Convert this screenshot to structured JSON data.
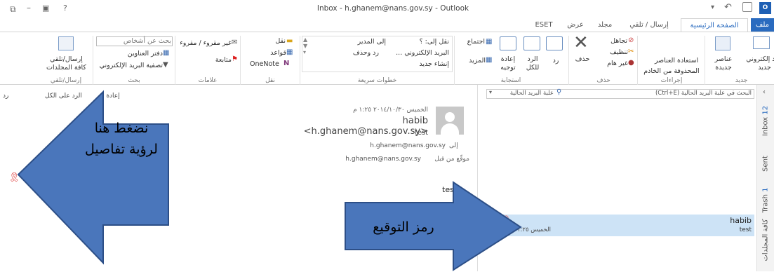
{
  "window": {
    "title": "Inbox - h.ghanem@nans.gov.sy - Outlook"
  },
  "tabs": {
    "file": "ملف",
    "home": "الصفحة الرئيسية",
    "send_receive": "إرسال / تلقي",
    "folder": "مجلد",
    "view": "عرض",
    "eset": "ESET"
  },
  "ribbon": {
    "new": {
      "new_email": "بريد إلكتروني جديد",
      "new_items": "عناصر جديدة",
      "label": "جديد"
    },
    "actions": {
      "restore": "استعادة العناصر",
      "from_server": "المحذوفة من الخادم",
      "label": "إجراءات"
    },
    "delete": {
      "ignore": "تجاهل",
      "cleanup": "تنظيف",
      "junk": "غير هام",
      "delete": "حذف",
      "label": "حذف"
    },
    "respond": {
      "reply": "رد",
      "reply_all": "الرد للكل",
      "forward": "إعادة توجيه",
      "meeting": "اجتماع",
      "more": "المزيد",
      "label": "استجابة"
    },
    "quicksteps": {
      "move_to": "نقل إلى: ؟",
      "to_manager": "إلى المدير",
      "team_email": "البريد الإلكتروني ...",
      "reply_delete": "رد وحذف",
      "create_new": "إنشاء جديد",
      "label": "خطوات سريعة"
    },
    "move": {
      "move": "نقل",
      "rules": "قواعد",
      "onenote": "OneNote",
      "label": "نقل"
    },
    "tags": {
      "unread": "غير مقروء / مقروء",
      "followup": "متابعة",
      "label": "علامات"
    },
    "find": {
      "search_people": "بحث عن أشخاص",
      "address_book": "دفتر العناوين",
      "filter_email": "تصفية البريد الإلكتروني",
      "label": "بحث"
    },
    "sendrecv": {
      "btn": "إرسال/تلقي كافة المجلدات",
      "label": "إرسال/تلقي"
    }
  },
  "mail_list": {
    "search_placeholder": "البحث في علبة البريد الحالية (Ctrl+E)",
    "scope": "علبة البريد الحالية",
    "item": {
      "sender": "habib",
      "subject": "test",
      "date": "الخميس ١:٢٥ م"
    }
  },
  "reading": {
    "reply_all": "الرد على الكل",
    "reply": "رد",
    "forward": "إعادة ت",
    "date": "الخميس ٢٠١٤/١٠/٣٠ ١:٢٥ م",
    "from": "habib <h.ghanem@nans.gov.sy>",
    "subject": "test",
    "to_label": "إلى",
    "to_value": "h.ghanem@nans.gov.sy",
    "signed_label": "موقّع من قبل",
    "signed_value": "h.ghanem@nans.gov.sy",
    "body": "test"
  },
  "sidebar": {
    "inbox": "Inbox",
    "inbox_count": "12",
    "sent": "Sent",
    "trash": "Trash",
    "trash_count": "1",
    "all": "كافة المجلدات"
  },
  "annotations": {
    "left": "نضغط هنا لرؤية تفاصيل",
    "right": "رمز التوقيع"
  }
}
